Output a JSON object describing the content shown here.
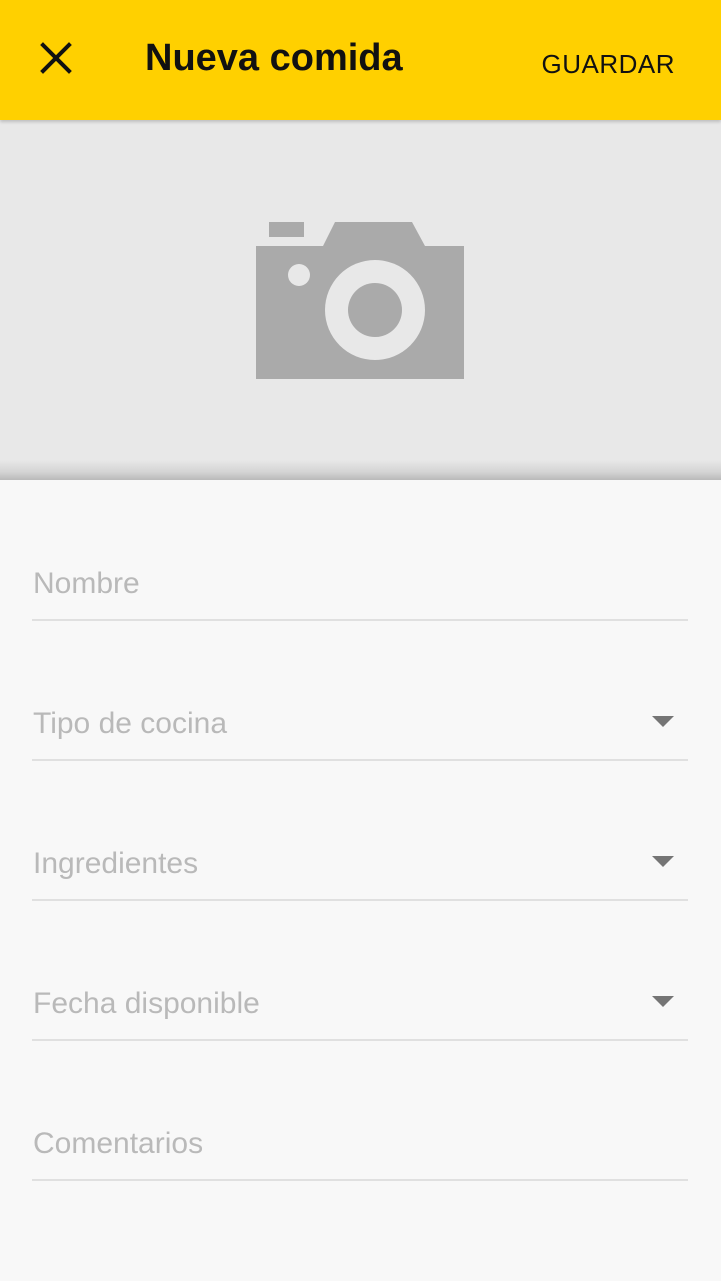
{
  "toolbar": {
    "title": "Nueva comida",
    "save_label": "GUARDAR",
    "close_icon": "close-icon",
    "background_color": "#ffd000"
  },
  "photo": {
    "icon": "camera-icon",
    "icon_color": "#aaaaaa",
    "background_color": "#e8e8e8"
  },
  "form": {
    "fields": [
      {
        "label": "Nombre",
        "type": "text"
      },
      {
        "label": "Tipo de cocina",
        "type": "dropdown"
      },
      {
        "label": "Ingredientes",
        "type": "dropdown"
      },
      {
        "label": "Fecha disponible",
        "type": "dropdown"
      },
      {
        "label": "Comentarios",
        "type": "text"
      }
    ]
  }
}
